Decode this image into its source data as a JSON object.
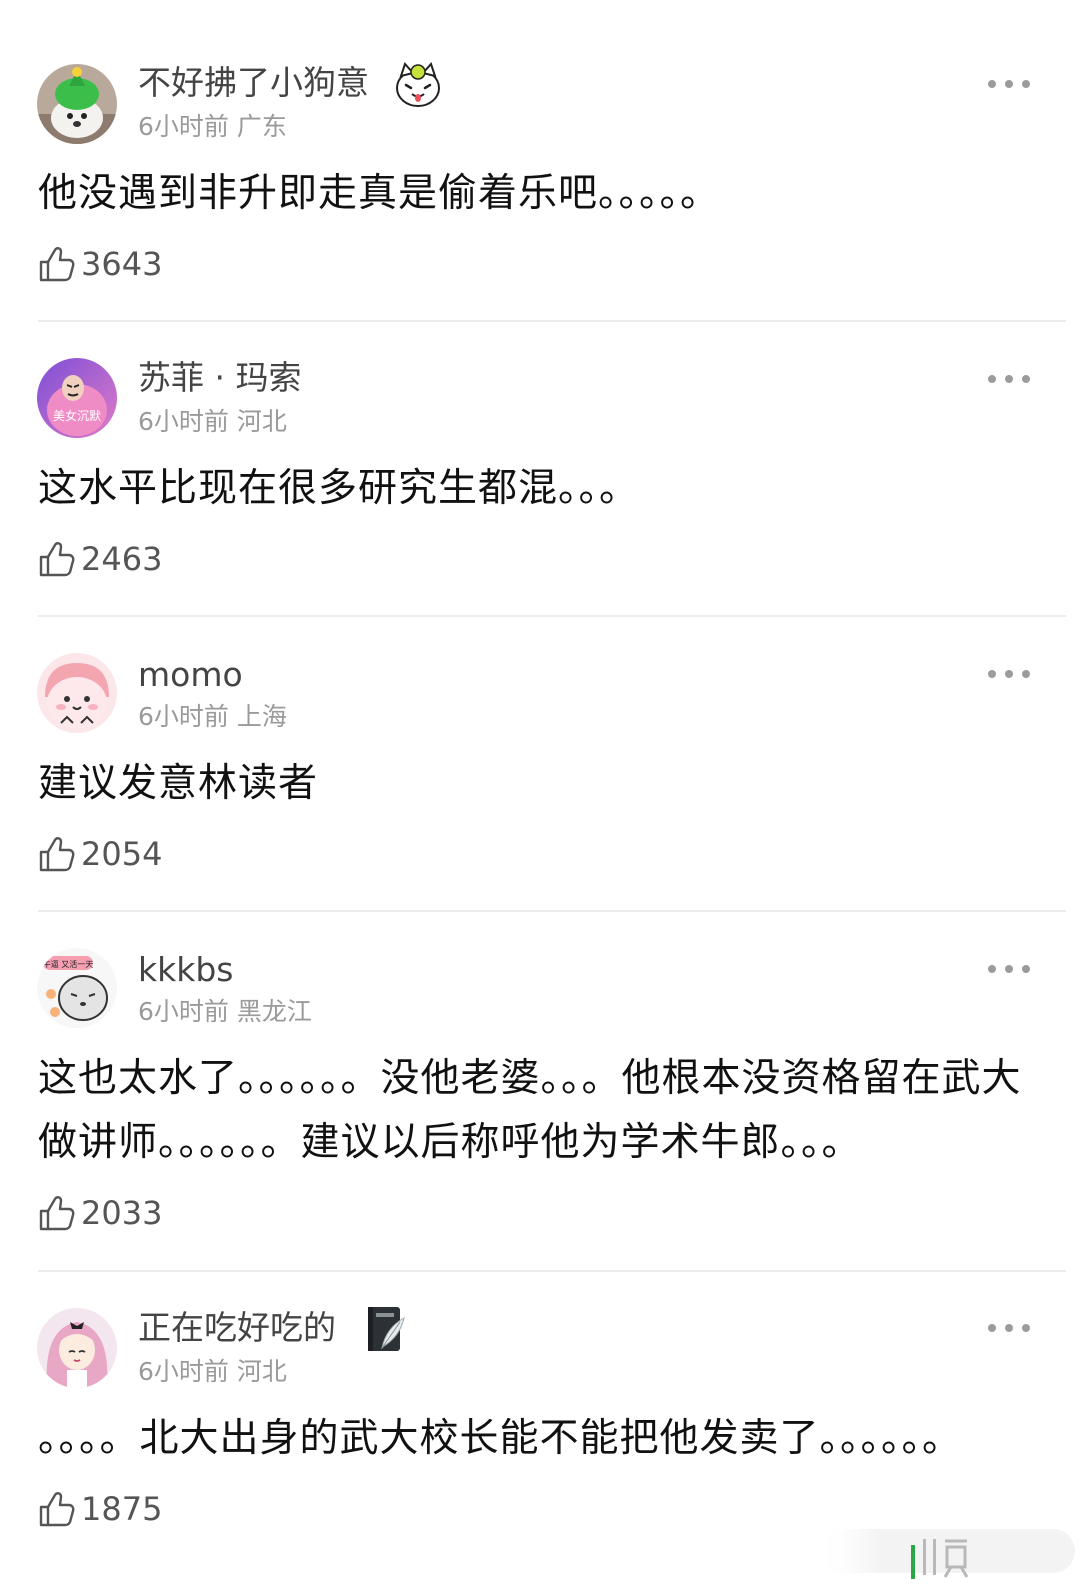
{
  "comments": [
    {
      "username": "不好拂了小狗意",
      "time": "6小时前",
      "location": "广东",
      "text": "他没遇到非升即走真是偷着乐吧。。。。。",
      "likes": "3643",
      "avatar_icon": "dog-with-green-hat-avatar",
      "badge_icon": "cartoon-cat-badge-icon"
    },
    {
      "username": "苏菲 · 玛索",
      "time": "6小时前",
      "location": "河北",
      "text": "这水平比现在很多研究生都混。。。",
      "likes": "2463",
      "avatar_icon": "pink-meme-avatar",
      "avatar_caption": "美女沉默"
    },
    {
      "username": "momo",
      "time": "6小时前",
      "location": "上海",
      "text": "建议发意林读者",
      "likes": "2054",
      "avatar_icon": "pink-cartoon-avatar"
    },
    {
      "username": "kkkbs",
      "time": "6小时前",
      "location": "黑龙江",
      "text": "这也太水了。。。。。。没他老婆。。。他根本没资格留在武大做讲师。。。。。。建议以后称呼他为学术牛郎。。。",
      "likes": "2033",
      "avatar_icon": "grey-cat-sticker-avatar",
      "avatar_caption": "牛逼 又活一天"
    },
    {
      "username": "正在吃好吃的",
      "time": "6小时前",
      "location": "河北",
      "text": "。。。。北大出身的武大校长能不能把他发卖了。。。。。。",
      "likes": "1875",
      "avatar_icon": "anime-girl-avatar",
      "badge_icon": "notebook-feather-badge-icon"
    }
  ],
  "watermark": {
    "icon": "watermark-logo",
    "color": "#2aa845"
  },
  "colors": {
    "username": "#444444",
    "meta": "#9a9a9a",
    "text": "#111111",
    "divider": "#ececec",
    "like": "#555555"
  }
}
